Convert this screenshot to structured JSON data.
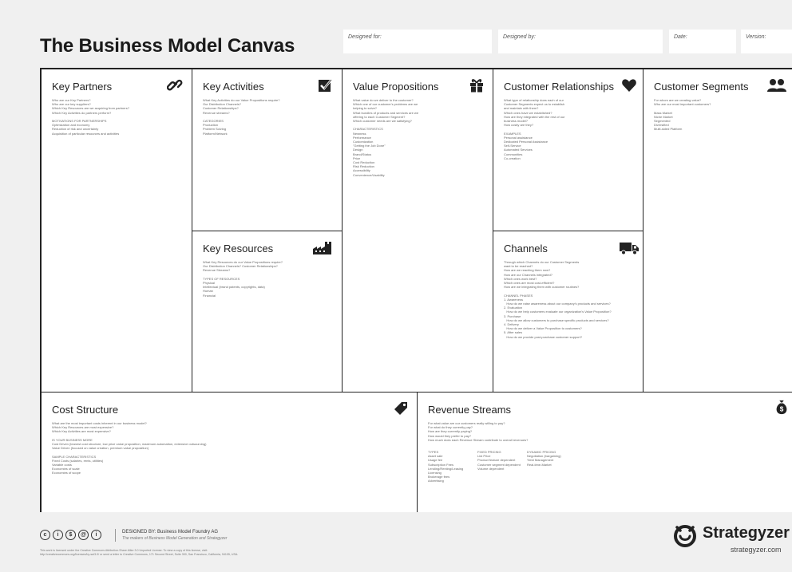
{
  "title": "The Business Model Canvas",
  "meta": {
    "designed_for": "Designed for:",
    "designed_by": "Designed by:",
    "date": "Date:",
    "version": "Version:"
  },
  "blocks": {
    "key_partners": {
      "title": "Key Partners",
      "icon": "link-icon",
      "text": "Who are our Key Partners?\nWho are our key suppliers?\nWhich Key Resources are we acquiring from partners?\nWhich Key Activities do partners perform?\n\nMOTIVATIONS FOR PARTNERSHIPS\nOptimization and economy\nReduction of risk and uncertainty\nAcquisition of particular resources and activities"
    },
    "key_activities": {
      "title": "Key Activities",
      "icon": "checkbox-icon",
      "text": "What Key Activities do our Value Propositions require?\nOur Distribution Channels?\nCustomer Relationships?\nRevenue streams?\n\nCATEGORIES\nProduction\nProblem Solving\nPlatform/Network"
    },
    "key_resources": {
      "title": "Key Resources",
      "icon": "factory-icon",
      "text": "What Key Resources do our Value Propositions require?\nOur Distribution Channels? Customer Relationships?\nRevenue Streams?\n\nTYPES OF RESOURCES\nPhysical\nIntellectual (brand patents, copyrights, data)\nHuman\nFinancial"
    },
    "value_propositions": {
      "title": "Value Propositions",
      "icon": "gift-icon",
      "text": "What value do we deliver to the customer?\nWhich one of our customer's problems are we\nhelping to solve?\nWhat bundles of products and services are we\noffering to each Customer Segment?\nWhich customer needs are we satisfying?\n\nCHARACTERISTICS\nNewness\nPerformance\nCustomization\n\"Getting the Job Done\"\nDesign\nBrand/Status\nPrice\nCost Reduction\nRisk Reduction\nAccessibility\nConvenience/Usability"
    },
    "customer_relationships": {
      "title": "Customer Relationships",
      "icon": "heart-icon",
      "text": "What type of relationship does each of our\nCustomer Segments expect us to establish\nand maintain with them?\nWhich ones have we established?\nHow are they integrated with the rest of our\nbusiness model?\nHow costly are they?\n\nEXAMPLES\nPersonal assistance\nDedicated Personal Assistance\nSelf-Service\nAutomated Services\nCommunities\nCo-creation"
    },
    "channels": {
      "title": "Channels",
      "icon": "truck-icon",
      "text": "Through which Channels do our Customer Segments\nwant to be reached?\nHow are we reaching them now?\nHow are our Channels integrated?\nWhich ones work best?\nWhich ones are most cost-efficient?\nHow are we integrating them with customer routines?\n\nCHANNEL PHASES\n1. Awareness\n   How do we raise awareness about our company's products and services?\n2. Evaluation\n   How do we help customers evaluate our organization's Value Proposition?\n3. Purchase\n   How do we allow customers to purchase specific products and services?\n4. Delivery\n   How do we deliver a Value Proposition to customers?\n5. After sales\n   How do we provide post-purchase customer support?"
    },
    "customer_segments": {
      "title": "Customer Segments",
      "icon": "people-icon",
      "text": "For whom are we creating value?\nWho are our most important customers?\n\nMass Market\nNiche Market\nSegmented\nDiversified\nMulti-sided Platform"
    },
    "cost_structure": {
      "title": "Cost Structure",
      "icon": "tag-icon",
      "text": "What are the most important costs inherent in our business model?\nWhich Key Resources are most expensive?\nWhich Key Activities are most expensive?\n\nIS YOUR BUSINESS MORE\nCost Driven (leanest cost structure, low price value proposition, maximum automation, extensive outsourcing)\nValue Driven (focused on value creation, premium value proposition)\n\nSAMPLE CHARACTERISTICS\nFixed Costs (salaries, rents, utilities)\nVariable costs\nEconomies of scale\nEconomies of scope"
    },
    "revenue_streams": {
      "title": "Revenue Streams",
      "icon": "moneybag-icon",
      "text": "For what value are our customers really willing to pay?\nFor what do they currently pay?\nHow are they currently paying?\nHow would they prefer to pay?\nHow much does each Revenue Stream contribute to overall revenues?",
      "col1": "TYPES\nAsset sale\nUsage fee\nSubscription Fees\nLending/Renting/Leasing\nLicensing\nBrokerage fees\nAdvertising",
      "col2": "FIXED PRICING\nList Price\nProduct feature dependent\nCustomer segment dependent\nVolume dependent",
      "col3": "DYNAMIC PRICING\nNegotiation (bargaining)\nYield Management\nReal-time-Market"
    }
  },
  "footer": {
    "designed_by": "DESIGNED BY: Business Model Foundry AG",
    "designed_sub": "The makers of Business Model Generation and Strategyzer",
    "legal": "This work is licensed under the Creative Commons Attribution-Share Alike 3.0 Unported License. To view a copy of this license, visit:\nhttp://creativecommons.org/licenses/by-sa/3.0/ or send a letter to Creative Commons, 171 Second Street, Suite 300, San Francisco, California, 94105, USA.",
    "brand": "Strategyzer",
    "url": "strategyzer.com"
  }
}
